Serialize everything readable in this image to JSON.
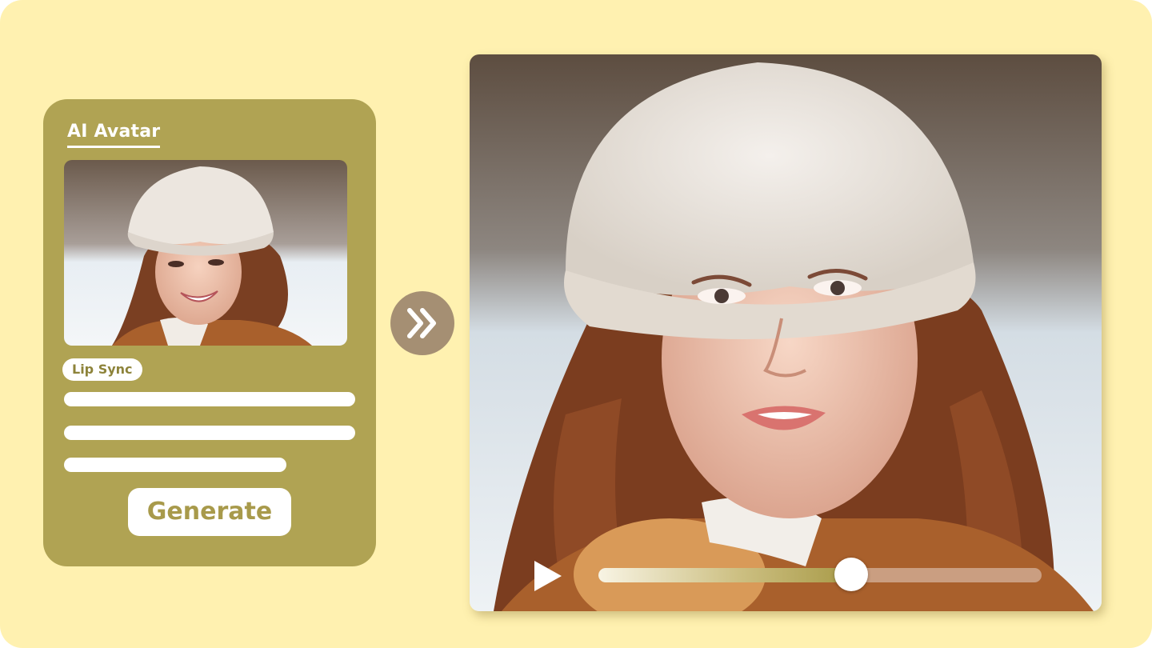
{
  "panel": {
    "title": "AI Avatar",
    "tag": "Lip Sync",
    "generate_label": "Generate"
  },
  "player": {
    "progress": 0.57
  },
  "icons": {
    "arrow": "double-chevron-right-icon",
    "play": "play-icon"
  },
  "colors": {
    "background": "#fff1b0",
    "panel": "#b0a353",
    "arrow_circle": "#a58f73",
    "button_text": "#a89a4b"
  }
}
